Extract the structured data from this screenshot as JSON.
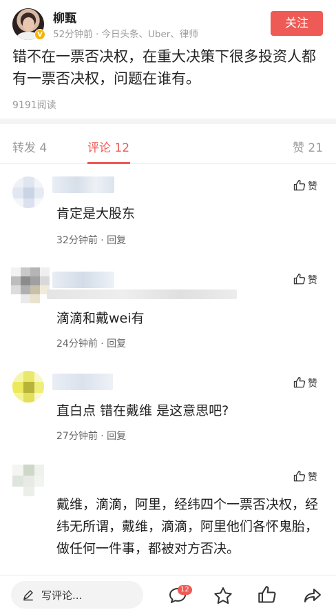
{
  "post": {
    "author": "柳甄",
    "verified_mark": "V",
    "meta": "52分钟前 · 今日头条、Uber、律师",
    "follow_label": "关注",
    "text": "错不在一票否决权，在重大决策下很多投资人都有一票否决权，问题在谁有。",
    "reads": "9191阅读"
  },
  "tabs": [
    {
      "label": "转发 4",
      "active": false
    },
    {
      "label": "评论 12",
      "active": true
    },
    {
      "label": "赞 21",
      "active": false
    }
  ],
  "comments": [
    {
      "text": "肯定是大股东",
      "meta": "32分钟前 · 回复",
      "like_label": "赞"
    },
    {
      "text": "滴滴和戴wei有",
      "meta": "24分钟前 · 回复",
      "like_label": "赞"
    },
    {
      "text": "直白点 错在戴维 是这意思吧?",
      "meta": "27分钟前 · 回复",
      "like_label": "赞"
    },
    {
      "text": "戴维，滴滴，阿里，经纬四个一票否决权，经纬无所谓，戴维，滴滴，阿里他们各怀鬼胎，做任何一件事，都被对方否决。",
      "meta": "",
      "like_label": "赞"
    }
  ],
  "bottom_bar": {
    "input_placeholder": "写评论...",
    "comment_badge": "12"
  },
  "colors": {
    "accent": "#ee5a55",
    "muted": "#999999"
  }
}
